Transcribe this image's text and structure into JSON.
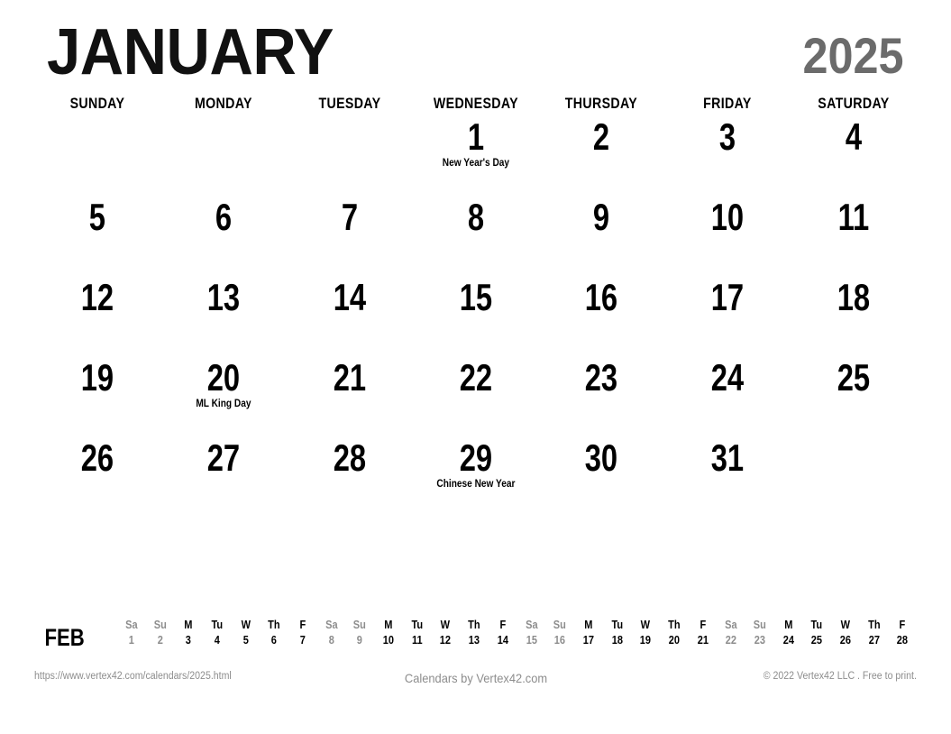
{
  "header": {
    "month": "JANUARY",
    "year": "2025",
    "month_color": "#111111",
    "year_color": "#6b6b6b"
  },
  "weekdays": [
    "SUNDAY",
    "MONDAY",
    "TUESDAY",
    "WEDNESDAY",
    "THURSDAY",
    "FRIDAY",
    "SATURDAY"
  ],
  "days": [
    {
      "number": "",
      "event": ""
    },
    {
      "number": "",
      "event": ""
    },
    {
      "number": "",
      "event": ""
    },
    {
      "number": "1",
      "event": "New Year's Day"
    },
    {
      "number": "2",
      "event": ""
    },
    {
      "number": "3",
      "event": ""
    },
    {
      "number": "4",
      "event": ""
    },
    {
      "number": "5",
      "event": ""
    },
    {
      "number": "6",
      "event": ""
    },
    {
      "number": "7",
      "event": ""
    },
    {
      "number": "8",
      "event": ""
    },
    {
      "number": "9",
      "event": ""
    },
    {
      "number": "10",
      "event": ""
    },
    {
      "number": "11",
      "event": ""
    },
    {
      "number": "12",
      "event": ""
    },
    {
      "number": "13",
      "event": ""
    },
    {
      "number": "14",
      "event": ""
    },
    {
      "number": "15",
      "event": ""
    },
    {
      "number": "16",
      "event": ""
    },
    {
      "number": "17",
      "event": ""
    },
    {
      "number": "18",
      "event": ""
    },
    {
      "number": "19",
      "event": ""
    },
    {
      "number": "20",
      "event": "ML King Day"
    },
    {
      "number": "21",
      "event": ""
    },
    {
      "number": "22",
      "event": ""
    },
    {
      "number": "23",
      "event": ""
    },
    {
      "number": "24",
      "event": ""
    },
    {
      "number": "25",
      "event": ""
    },
    {
      "number": "26",
      "event": ""
    },
    {
      "number": "27",
      "event": ""
    },
    {
      "number": "28",
      "event": ""
    },
    {
      "number": "29",
      "event": "Chinese New Year"
    },
    {
      "number": "30",
      "event": ""
    },
    {
      "number": "31",
      "event": ""
    },
    {
      "number": "",
      "event": ""
    }
  ],
  "mini_month": {
    "label": "FEB",
    "weekend_color": "#8d8d8d",
    "weekday_color": "#000000",
    "days": [
      {
        "dow": "Sa",
        "date": "1",
        "weekend": true
      },
      {
        "dow": "Su",
        "date": "2",
        "weekend": true
      },
      {
        "dow": "M",
        "date": "3",
        "weekend": false
      },
      {
        "dow": "Tu",
        "date": "4",
        "weekend": false
      },
      {
        "dow": "W",
        "date": "5",
        "weekend": false
      },
      {
        "dow": "Th",
        "date": "6",
        "weekend": false
      },
      {
        "dow": "F",
        "date": "7",
        "weekend": false
      },
      {
        "dow": "Sa",
        "date": "8",
        "weekend": true
      },
      {
        "dow": "Su",
        "date": "9",
        "weekend": true
      },
      {
        "dow": "M",
        "date": "10",
        "weekend": false
      },
      {
        "dow": "Tu",
        "date": "11",
        "weekend": false
      },
      {
        "dow": "W",
        "date": "12",
        "weekend": false
      },
      {
        "dow": "Th",
        "date": "13",
        "weekend": false
      },
      {
        "dow": "F",
        "date": "14",
        "weekend": false
      },
      {
        "dow": "Sa",
        "date": "15",
        "weekend": true
      },
      {
        "dow": "Su",
        "date": "16",
        "weekend": true
      },
      {
        "dow": "M",
        "date": "17",
        "weekend": false
      },
      {
        "dow": "Tu",
        "date": "18",
        "weekend": false
      },
      {
        "dow": "W",
        "date": "19",
        "weekend": false
      },
      {
        "dow": "Th",
        "date": "20",
        "weekend": false
      },
      {
        "dow": "F",
        "date": "21",
        "weekend": false
      },
      {
        "dow": "Sa",
        "date": "22",
        "weekend": true
      },
      {
        "dow": "Su",
        "date": "23",
        "weekend": true
      },
      {
        "dow": "M",
        "date": "24",
        "weekend": false
      },
      {
        "dow": "Tu",
        "date": "25",
        "weekend": false
      },
      {
        "dow": "W",
        "date": "26",
        "weekend": false
      },
      {
        "dow": "Th",
        "date": "27",
        "weekend": false
      },
      {
        "dow": "F",
        "date": "28",
        "weekend": false
      }
    ]
  },
  "footer": {
    "url": "https://www.vertex42.com/calendars/2025.html",
    "center": "Calendars by Vertex42.com",
    "copyright": "© 2022 Vertex42 LLC . Free to print.",
    "color": "#8d8d8d"
  }
}
